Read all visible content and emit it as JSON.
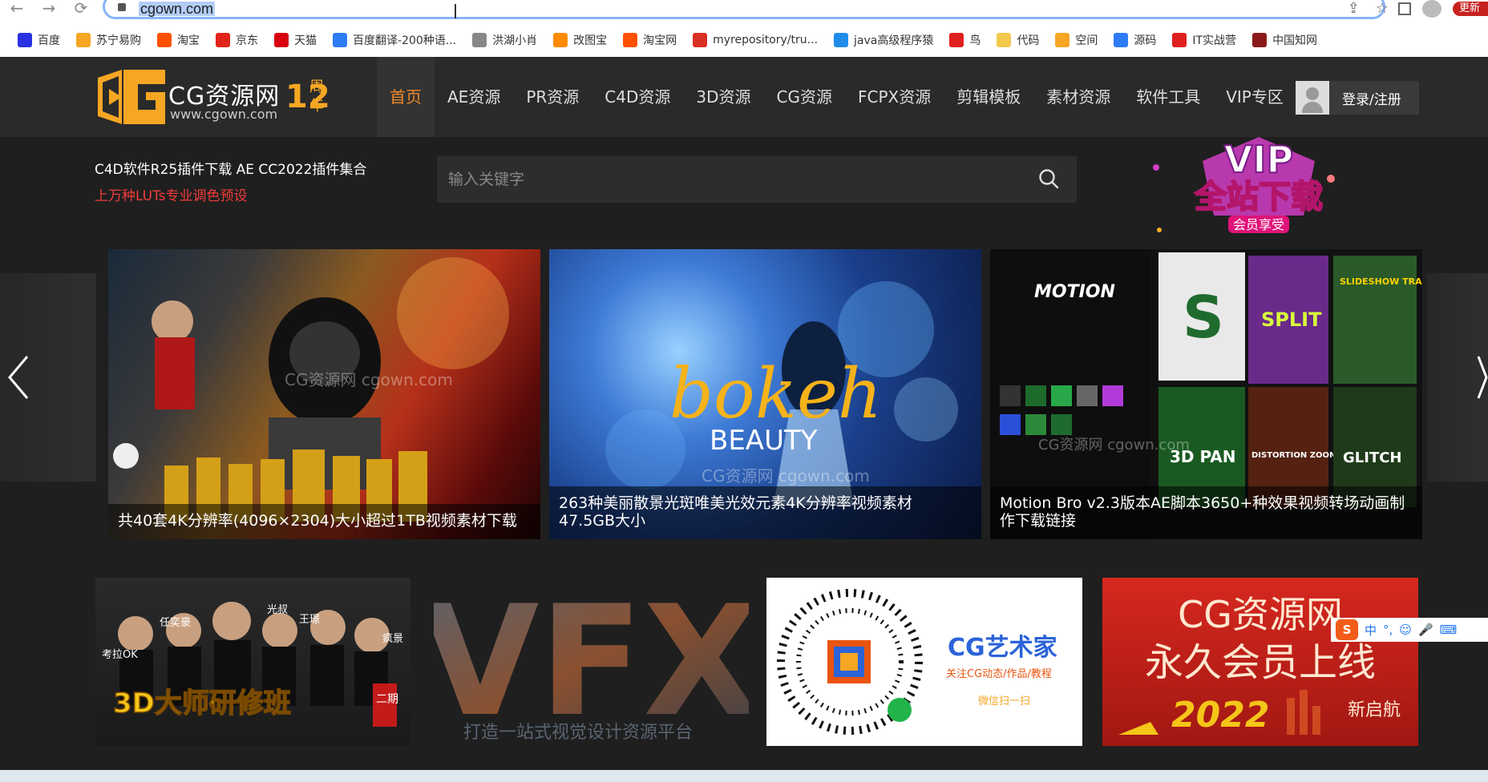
{
  "browser": {
    "url": "cgown.com",
    "update_label": "更新",
    "bookmarks": [
      {
        "label": "百度",
        "color": "#2932e1"
      },
      {
        "label": "苏宁易购",
        "color": "#f5a623"
      },
      {
        "label": "淘宝",
        "color": "#ff5000"
      },
      {
        "label": "京东",
        "color": "#e1251b"
      },
      {
        "label": "天猫",
        "color": "#d8000f"
      },
      {
        "label": "百度翻译-200种语...",
        "color": "#2e7bf6"
      },
      {
        "label": "洪湖小肖",
        "color": "#888888"
      },
      {
        "label": "改图宝",
        "color": "#ff8a00"
      },
      {
        "label": "淘宝网",
        "color": "#ff5000"
      },
      {
        "label": "myrepository/tru...",
        "color": "#d93025"
      },
      {
        "label": "java高级程序猿",
        "color": "#1f8ceb"
      },
      {
        "label": "鸟",
        "color": "#e02020"
      },
      {
        "label": "代码",
        "color": "#f2c94c"
      },
      {
        "label": "空间",
        "color": "#f5a623"
      },
      {
        "label": "源码",
        "color": "#2e7bf6"
      },
      {
        "label": "IT实战营",
        "color": "#e02020"
      },
      {
        "label": "中国知网",
        "color": "#8a1a1a"
      }
    ]
  },
  "site": {
    "logo": {
      "name": "CG资源网",
      "domain": "www.cgown.com",
      "years": "12",
      "years_suffix": "周年"
    },
    "nav": [
      "首页",
      "AE资源",
      "PR资源",
      "C4D资源",
      "3D资源",
      "CG资源",
      "FCPX资源",
      "剪辑模板",
      "素材资源",
      "软件工具",
      "VIP专区"
    ],
    "login_label": "登录/注册",
    "promo_line1": "C4D软件R25插件下载  AE CC2022插件集合",
    "promo_line2": "上万种LUTs专业调色预设",
    "search_placeholder": "输入关键字",
    "vip": {
      "title": "VIP",
      "subtitle": "全站下载",
      "badge": "会员享受"
    },
    "slides": [
      {
        "caption": "共40套4K分辨率(4096×2304)大小超过1TB视频素材下载",
        "watermark": "CG资源网 cgown.com"
      },
      {
        "caption": "263种美丽散景光斑唯美光效元素4K分辨率视频素材 47.5GB大小",
        "title": "bokeh",
        "subtitle": "BEAUTY",
        "watermark": "CG资源网 cgown.com"
      },
      {
        "caption": "Motion Bro v2.3版本AE脚本3650+种效果视频转场动画制作下载链接",
        "brand": "MOTION",
        "tiles": [
          "S",
          "SPLIT",
          "3D PAN",
          "DISTORTION ZOOM",
          "GLITCH",
          "SLIDESHOW TRANSITIONS PACK"
        ],
        "watermark": "CG资源网 cgown.com"
      }
    ],
    "banners": [
      {
        "title": "3D大师研修班",
        "badge": "二期",
        "names": [
          "考拉OK",
          "任奕豪",
          "光叔",
          "王璟",
          "疯景"
        ]
      },
      {
        "title": "VFX",
        "subtitle": "打造一站式视觉设计资源平台"
      },
      {
        "title": "CG艺术家",
        "subtitle": "关注CG动态/作品/教程",
        "hint": "微信扫一扫"
      },
      {
        "line1": "CG资源网",
        "line2": "永久会员上线",
        "year": "2022",
        "tag": "新启航"
      }
    ],
    "ime_label": "中"
  }
}
